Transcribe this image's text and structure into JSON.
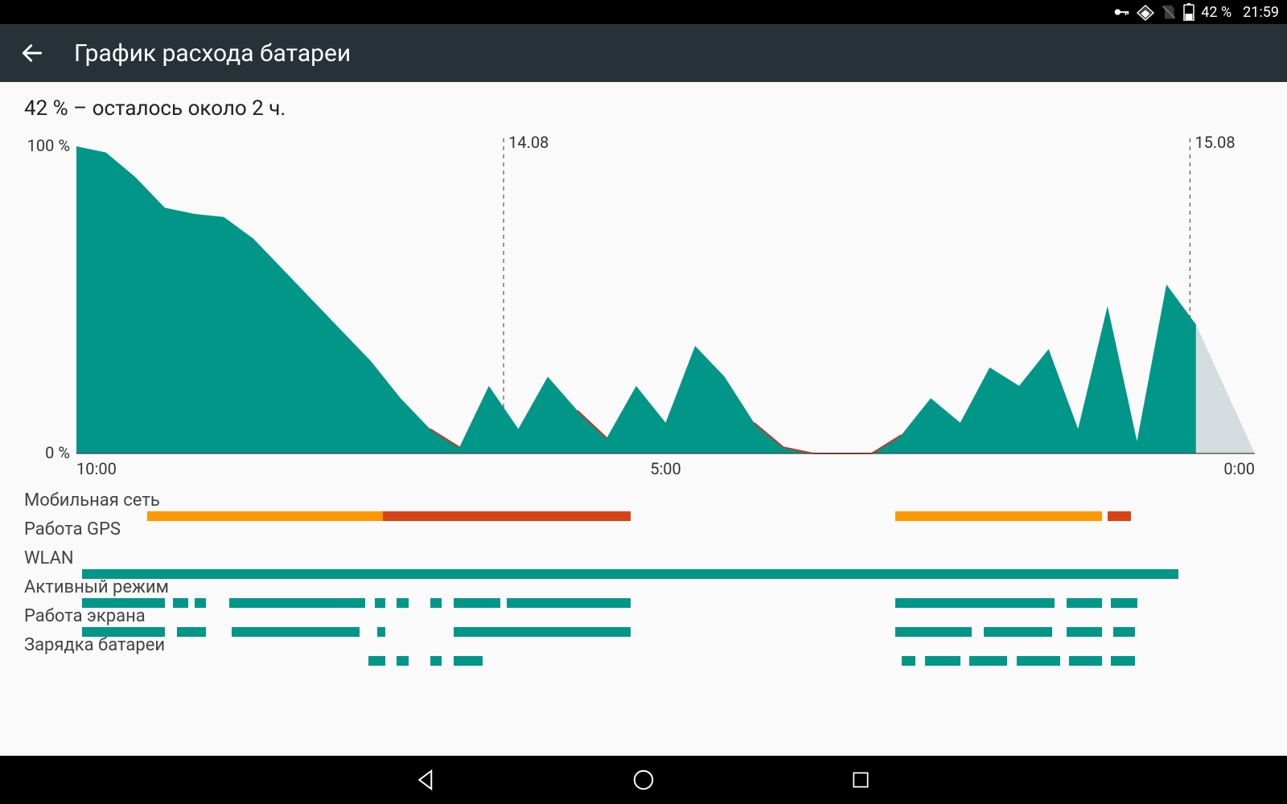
{
  "status_bar": {
    "battery_text": "42 %",
    "time": "21:59"
  },
  "app_bar": {
    "title": "График расхода батареи"
  },
  "summary": "42 % – осталось около 2 ч.",
  "chart_data": {
    "type": "area",
    "title": "",
    "xlabel": "",
    "ylabel": "",
    "y_axis_labels": {
      "top": "100 %",
      "bottom": "0 %"
    },
    "x_axis_ticks": [
      "10:00",
      "5:00",
      "0:00"
    ],
    "day_markers": [
      "14.08",
      "15.08"
    ],
    "x": [
      0,
      1,
      2,
      3,
      4,
      5,
      6,
      7,
      8,
      9,
      10,
      11,
      12,
      13,
      14,
      15,
      16,
      17,
      18,
      19,
      20,
      21,
      22,
      23,
      24,
      25,
      26,
      27,
      28,
      29,
      30,
      31,
      32,
      33,
      34,
      35,
      36,
      37,
      38
    ],
    "series": [
      {
        "name": "battery_level",
        "color": "#009688",
        "values": [
          100,
          98,
          90,
          80,
          78,
          77,
          70,
          60,
          50,
          40,
          30,
          18,
          8,
          2,
          22,
          8,
          25,
          14,
          5,
          22,
          10,
          35,
          25,
          10,
          2,
          0,
          0,
          0,
          6,
          18,
          10,
          28,
          22,
          34,
          8,
          48,
          4,
          55,
          42
        ]
      },
      {
        "name": "predicted",
        "color": "#cfd8dc",
        "values": [
          null,
          null,
          null,
          null,
          null,
          null,
          null,
          null,
          null,
          null,
          null,
          null,
          null,
          null,
          null,
          null,
          null,
          null,
          null,
          null,
          null,
          null,
          null,
          null,
          null,
          null,
          null,
          null,
          null,
          null,
          null,
          null,
          null,
          null,
          null,
          null,
          null,
          null,
          42
        ]
      }
    ],
    "predicted_end": {
      "x": 40,
      "value": 0
    },
    "ylim": [
      0,
      100
    ],
    "xlim": [
      0,
      40
    ]
  },
  "timeline_rows": [
    {
      "label": "Мобильная сеть",
      "segments": [
        {
          "start": 0.06,
          "end": 0.26,
          "color": "#ff9800"
        },
        {
          "start": 0.26,
          "end": 0.47,
          "color": "#d84315"
        },
        {
          "start": 0.695,
          "end": 0.87,
          "color": "#ff9800"
        },
        {
          "start": 0.875,
          "end": 0.895,
          "color": "#d84315"
        }
      ]
    },
    {
      "label": "Работа GPS",
      "segments": []
    },
    {
      "label": "WLAN",
      "segments": [
        {
          "start": 0.005,
          "end": 0.935,
          "color": "#009688"
        }
      ]
    },
    {
      "label": "Активный режим",
      "segments": [
        {
          "start": 0.005,
          "end": 0.075,
          "color": "#009688"
        },
        {
          "start": 0.082,
          "end": 0.095,
          "color": "#009688"
        },
        {
          "start": 0.1,
          "end": 0.11,
          "color": "#009688"
        },
        {
          "start": 0.13,
          "end": 0.245,
          "color": "#009688"
        },
        {
          "start": 0.253,
          "end": 0.262,
          "color": "#009688"
        },
        {
          "start": 0.272,
          "end": 0.282,
          "color": "#009688"
        },
        {
          "start": 0.3,
          "end": 0.31,
          "color": "#009688"
        },
        {
          "start": 0.32,
          "end": 0.36,
          "color": "#009688"
        },
        {
          "start": 0.365,
          "end": 0.47,
          "color": "#009688"
        },
        {
          "start": 0.695,
          "end": 0.83,
          "color": "#009688"
        },
        {
          "start": 0.84,
          "end": 0.87,
          "color": "#009688"
        },
        {
          "start": 0.878,
          "end": 0.9,
          "color": "#009688"
        }
      ]
    },
    {
      "label": "Работа экрана",
      "segments": [
        {
          "start": 0.005,
          "end": 0.075,
          "color": "#009688"
        },
        {
          "start": 0.085,
          "end": 0.11,
          "color": "#009688"
        },
        {
          "start": 0.132,
          "end": 0.24,
          "color": "#009688"
        },
        {
          "start": 0.255,
          "end": 0.262,
          "color": "#009688"
        },
        {
          "start": 0.32,
          "end": 0.47,
          "color": "#009688"
        },
        {
          "start": 0.695,
          "end": 0.76,
          "color": "#009688"
        },
        {
          "start": 0.77,
          "end": 0.828,
          "color": "#009688"
        },
        {
          "start": 0.84,
          "end": 0.87,
          "color": "#009688"
        },
        {
          "start": 0.88,
          "end": 0.898,
          "color": "#009688"
        }
      ]
    },
    {
      "label": "Зарядка батареи",
      "segments": [
        {
          "start": 0.248,
          "end": 0.262,
          "color": "#009688"
        },
        {
          "start": 0.272,
          "end": 0.282,
          "color": "#009688"
        },
        {
          "start": 0.3,
          "end": 0.31,
          "color": "#009688"
        },
        {
          "start": 0.32,
          "end": 0.345,
          "color": "#009688"
        },
        {
          "start": 0.7,
          "end": 0.712,
          "color": "#009688"
        },
        {
          "start": 0.72,
          "end": 0.75,
          "color": "#009688"
        },
        {
          "start": 0.758,
          "end": 0.79,
          "color": "#009688"
        },
        {
          "start": 0.798,
          "end": 0.835,
          "color": "#009688"
        },
        {
          "start": 0.842,
          "end": 0.87,
          "color": "#009688"
        },
        {
          "start": 0.878,
          "end": 0.898,
          "color": "#009688"
        }
      ]
    }
  ],
  "colors": {
    "teal": "#009688",
    "orange": "#ff9800",
    "red": "#d84315",
    "grey": "#cfd8dc",
    "axis": "#555"
  }
}
